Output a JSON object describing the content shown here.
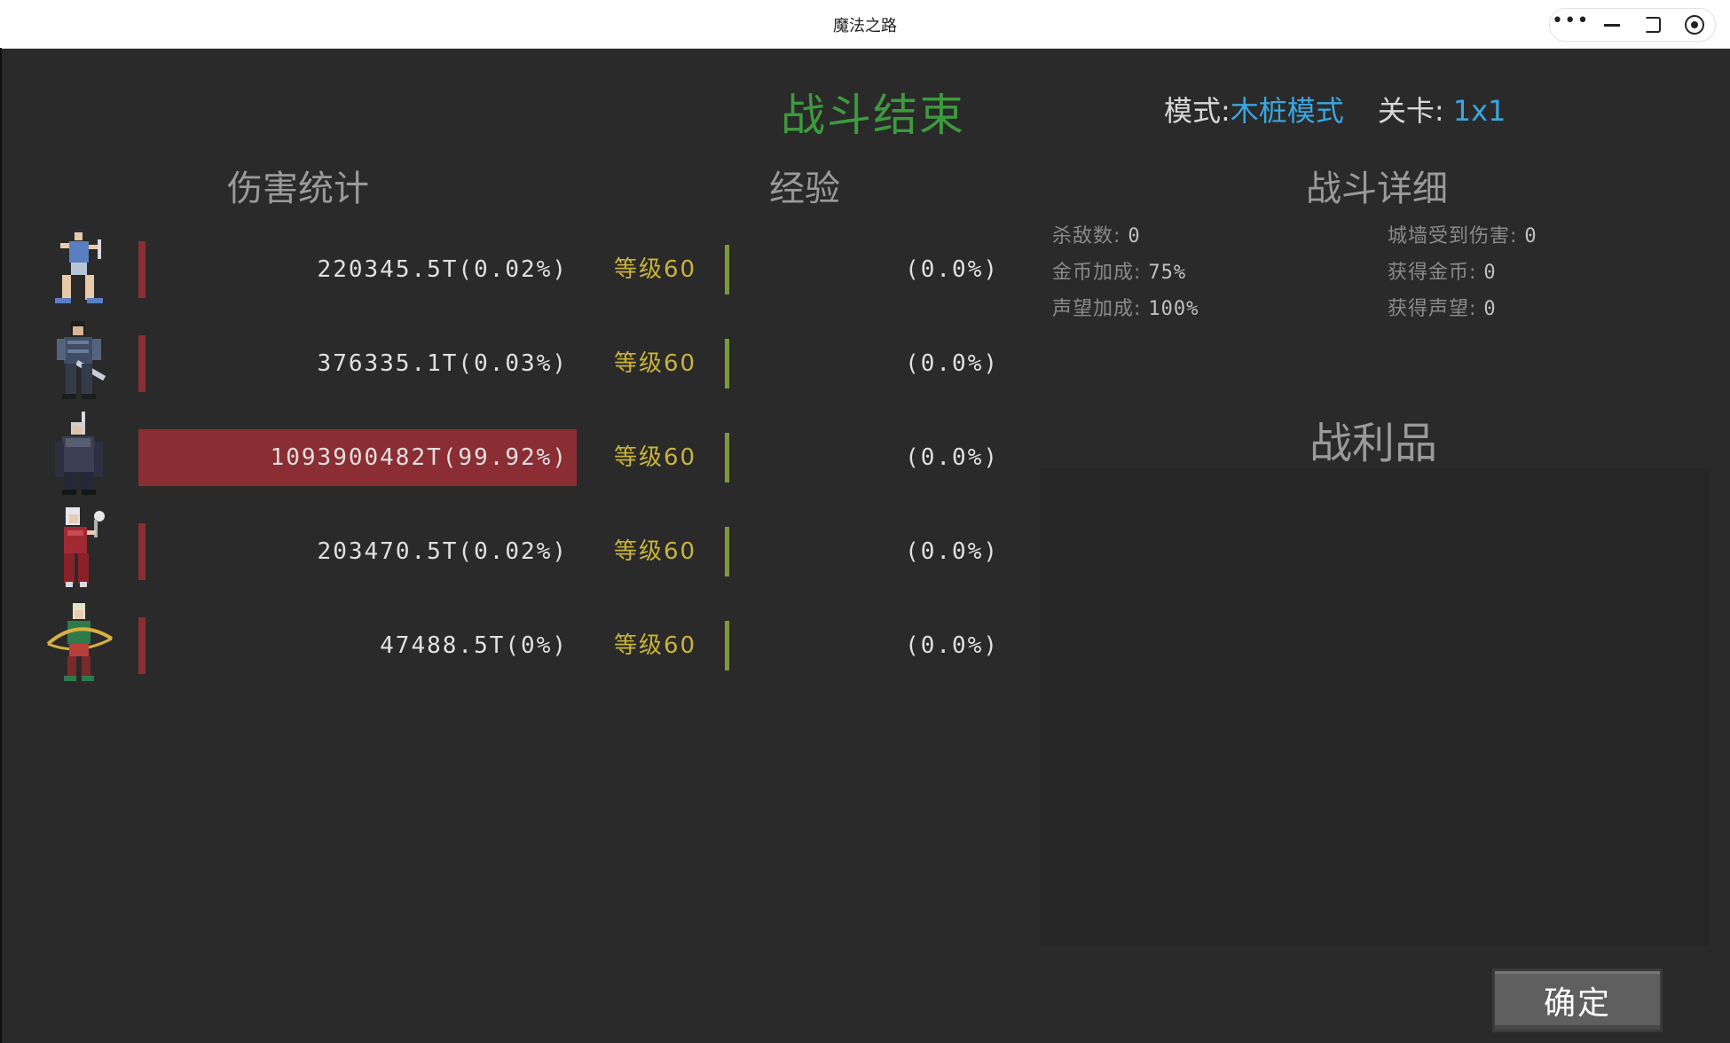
{
  "window": {
    "title": "魔法之路"
  },
  "header": {
    "battle_title": "战斗结束",
    "mode_label": "模式:",
    "mode_value": "木桩模式",
    "stage_label": "关卡:",
    "stage_value": "1x1"
  },
  "sections": {
    "damage": "伤害统计",
    "exp": "经验",
    "details": "战斗详细",
    "loot": "战利品"
  },
  "heroes": [
    {
      "damage": "220345.5T(0.02%)",
      "damage_share": 0.0002,
      "level": "等级60",
      "exp": "(0.0%)",
      "avatar": "warrior-woman-icon"
    },
    {
      "damage": "376335.1T(0.03%)",
      "damage_share": 0.0003,
      "level": "等级60",
      "exp": "(0.0%)",
      "avatar": "knight-icon"
    },
    {
      "damage": "1093900482T(99.92%)",
      "damage_share": 0.9992,
      "level": "等级60",
      "exp": "(0.0%)",
      "avatar": "dark-swordsman-icon"
    },
    {
      "damage": "203470.5T(0.02%)",
      "damage_share": 0.0002,
      "level": "等级60",
      "exp": "(0.0%)",
      "avatar": "sorceress-icon"
    },
    {
      "damage": "47488.5T(0%)",
      "damage_share": 0.0,
      "level": "等级60",
      "exp": "(0.0%)",
      "avatar": "elf-archer-icon"
    }
  ],
  "details": {
    "kills_label": "杀敌数:",
    "kills": "0",
    "wall_damage_label": "城墙受到伤害:",
    "wall_damage": "0",
    "gold_bonus_label": "金币加成:",
    "gold_bonus": "75%",
    "gold_gained_label": "获得金币:",
    "gold_gained": "0",
    "fame_bonus_label": "声望加成:",
    "fame_bonus": "100%",
    "fame_gained_label": "获得声望:",
    "fame_gained": "0"
  },
  "actions": {
    "confirm": "确定"
  },
  "colors": {
    "background": "#2a2a2a",
    "title_green": "#3d9a3d",
    "accent_blue": "#3aa6e0",
    "damage_red": "#8b2e33",
    "level_gold": "#c9b33a",
    "exp_green": "#7c9a3c"
  }
}
